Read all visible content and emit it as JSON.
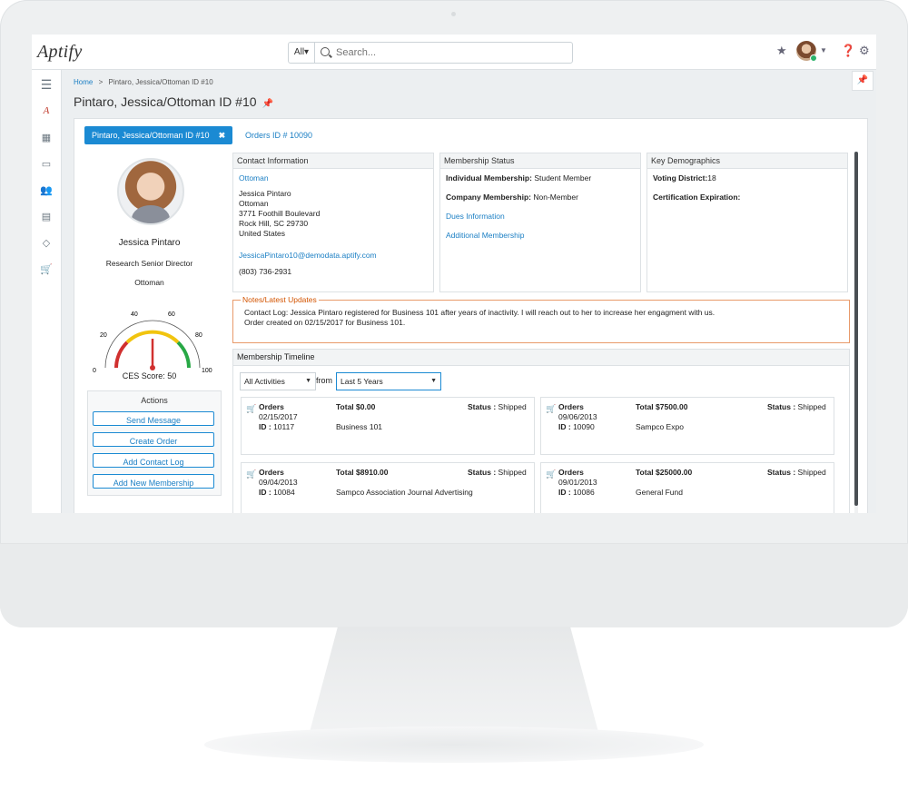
{
  "topbar": {
    "logo": "Aptify",
    "search_scope": "All▾",
    "search_placeholder": "Search..."
  },
  "breadcrumb": {
    "home": "Home",
    "separator": ">",
    "current": "Pintaro, Jessica/Ottoman ID #10"
  },
  "page_title": "Pintaro, Jessica/Ottoman ID #10",
  "tabs": {
    "active": "Pintaro, Jessica/Ottoman ID #10",
    "close": "✖",
    "other": "Orders ID # 10090"
  },
  "profile": {
    "name": "Jessica Pintaro",
    "title": "Research Senior Director",
    "company": "Ottoman",
    "gauge_labels": [
      "0",
      "20",
      "40",
      "60",
      "80",
      "100"
    ],
    "ces_score": 50,
    "ces_label": "CES Score: 50"
  },
  "actions": {
    "title": "Actions",
    "buttons": [
      "Send Message",
      "Create Order",
      "Add Contact Log",
      "Add New Membership"
    ]
  },
  "contact": {
    "header": "Contact Information",
    "company_link": "Ottoman",
    "lines": [
      "Jessica Pintaro",
      "Ottoman",
      "3771 Foothill Boulevard",
      "Rock Hill, SC 29730",
      "United States"
    ],
    "email": "JessicaPintaro10@demodata.aptify.com",
    "phone": "(803) 736-2931"
  },
  "membership": {
    "header": "Membership Status",
    "individual_label": "Individual Membership:",
    "individual_value": "Student Member",
    "company_label": "Company Membership:",
    "company_value": "Non-Member",
    "link1": "Dues Information",
    "link2": "Additional Membership"
  },
  "demographics": {
    "header": "Key Demographics",
    "voting_label": "Voting District:",
    "voting_value": "18",
    "cert_label": "Certification Expiration:"
  },
  "notes": {
    "header": "Notes/Latest Updates",
    "line1": "Contact Log: Jessica Pintaro registered for Business 101 after years of inactivity. I will reach out to her to increase her engagment with us.",
    "line2": "Order created on 02/15/2017 for Business 101."
  },
  "timeline": {
    "header": "Membership Timeline",
    "filter": "All Activities",
    "from": "from",
    "range": "Last 5 Years",
    "orders": [
      {
        "type": "Orders",
        "date": "02/15/2017",
        "id_label": "ID :",
        "id": "10117",
        "total": "Total $0.00",
        "desc": "Business 101",
        "status_label": "Status :",
        "status": "Shipped"
      },
      {
        "type": "Orders",
        "date": "09/06/2013",
        "id_label": "ID :",
        "id": "10090",
        "total": "Total $7500.00",
        "desc": "Sampco Expo",
        "status_label": "Status :",
        "status": "Shipped"
      },
      {
        "type": "Orders",
        "date": "09/04/2013",
        "id_label": "ID :",
        "id": "10084",
        "total": "Total $8910.00",
        "desc": "Sampco Association Journal Advertising",
        "status_label": "Status :",
        "status": "Shipped"
      },
      {
        "type": "Orders",
        "date": "09/01/2013",
        "id_label": "ID :",
        "id": "10086",
        "total": "Total $25000.00",
        "desc": "General Fund",
        "status_label": "Status :",
        "status": "Shipped"
      }
    ]
  }
}
